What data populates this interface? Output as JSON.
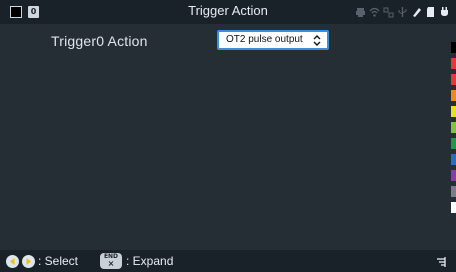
{
  "header": {
    "badge": "0",
    "title": "Trigger Action"
  },
  "main": {
    "label": "Trigger0  Action",
    "dropdown": {
      "value": "OT2 pulse output"
    }
  },
  "color_strip": [
    "#000000",
    "#e23a3a",
    "#e23a3a",
    "#ee8a1c",
    "#e8e020",
    "#7fc242",
    "#1c9a4a",
    "#2a6cc2",
    "#8e3aa4",
    "#7a7f85",
    "#ffffff"
  ],
  "footer": {
    "select_label": ": Select",
    "end_key_top": "END",
    "end_key_bottom": "×",
    "expand_label": ": Expand"
  },
  "icons": {
    "printer": "printer-icon",
    "wifi": "wifi-icon",
    "network": "network-icon",
    "usb": "usb-icon",
    "probe": "probe-icon",
    "sd": "sd-card-icon",
    "power": "power-icon",
    "left": "left-arrow-icon",
    "right": "right-arrow-icon",
    "menu": "menu-icon"
  }
}
